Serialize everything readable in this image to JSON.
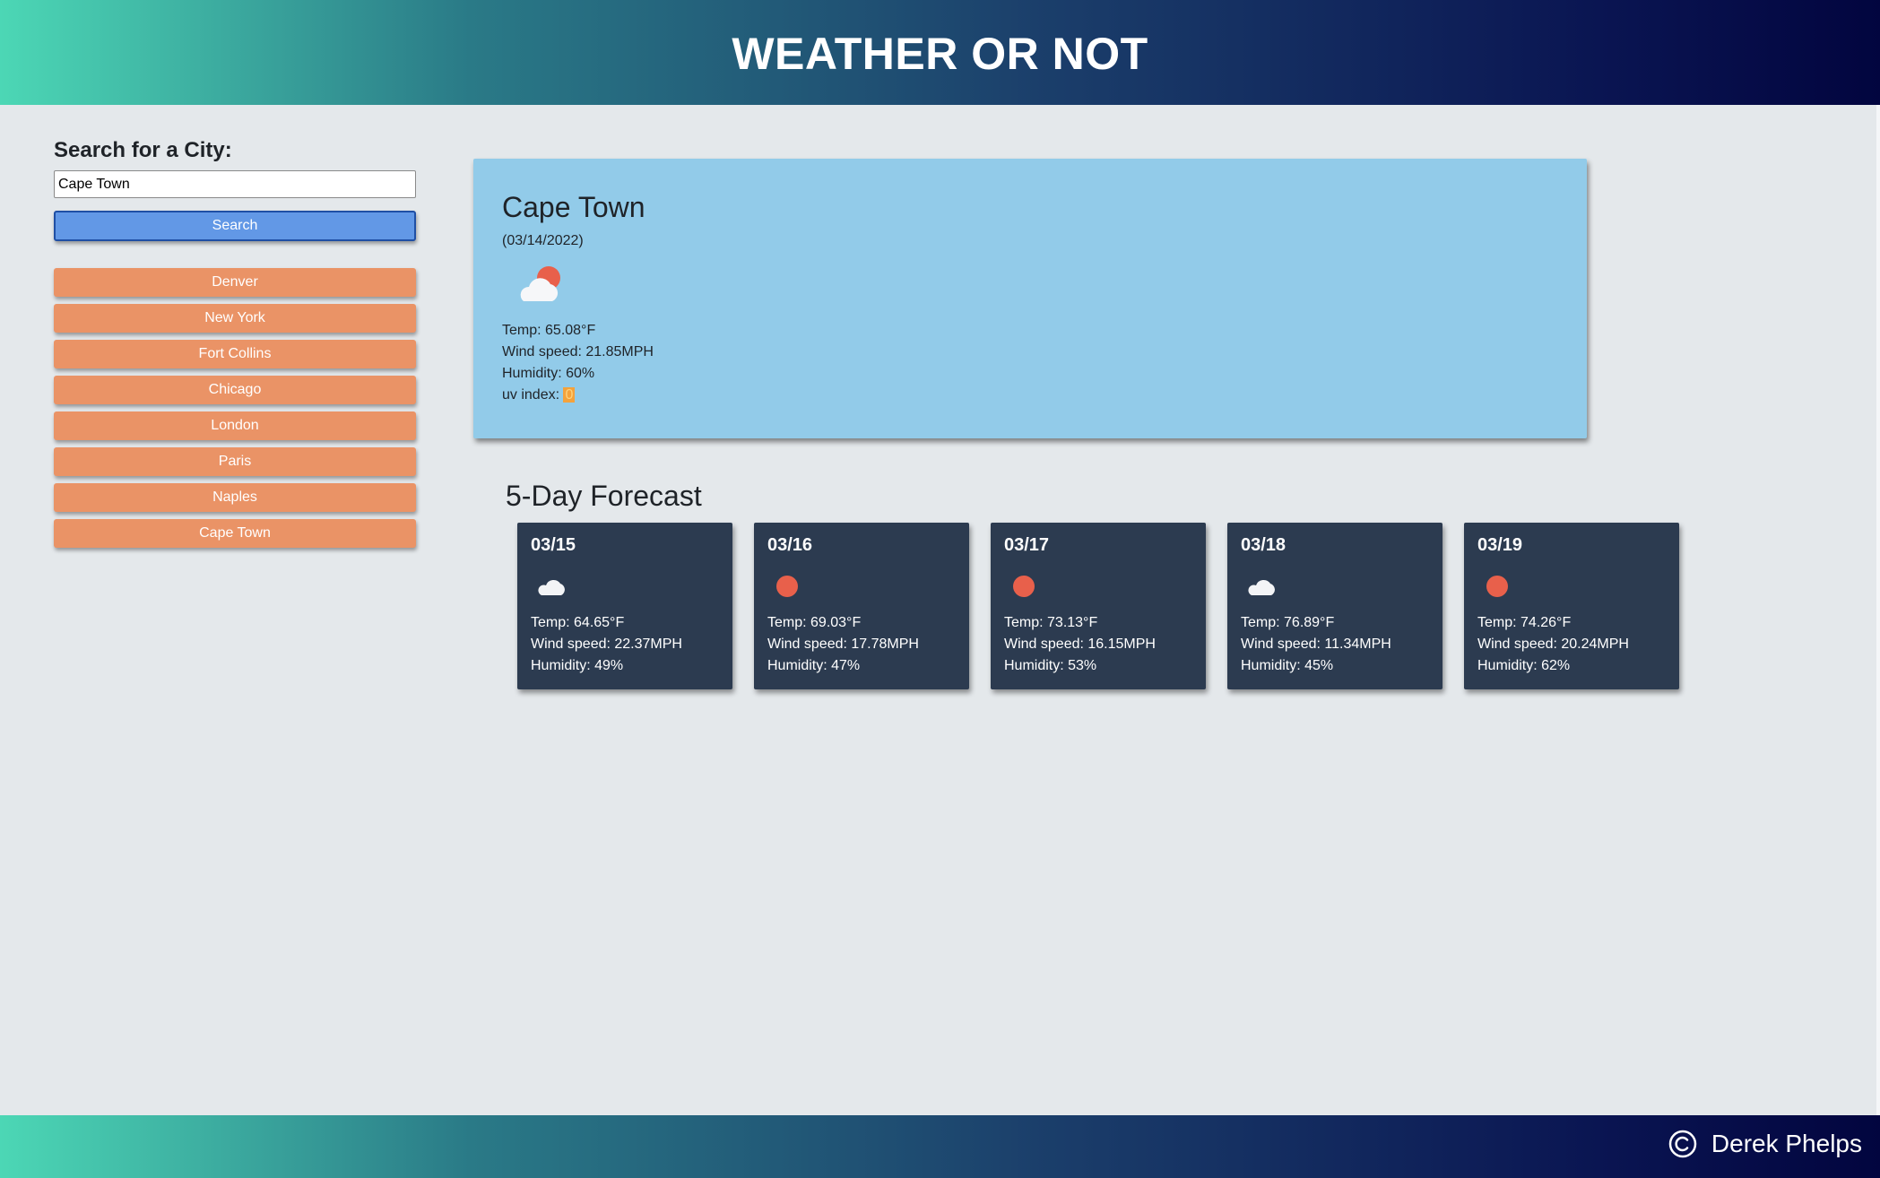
{
  "header": {
    "title": "WEATHER OR NOT"
  },
  "sidebar": {
    "search_label": "Search for a City:",
    "search_value": "Cape Town",
    "search_button": "Search",
    "history": [
      "Denver",
      "New York",
      "Fort Collins",
      "Chicago",
      "London",
      "Paris",
      "Naples",
      "Cape Town"
    ]
  },
  "current": {
    "city": "Cape Town",
    "date": "(03/14/2022)",
    "icon": "partly-cloudy-icon",
    "temp": "Temp: 65.08°F",
    "wind": "Wind speed: 21.85MPH",
    "humidity": "Humidity: 60%",
    "uv_label": "uv index: ",
    "uv_value": "0"
  },
  "forecast": {
    "title": "5-Day Forecast",
    "days": [
      {
        "date": "03/15",
        "icon": "cloud-icon",
        "temp": "Temp: 64.65°F",
        "wind": "Wind speed: 22.37MPH",
        "humidity": "Humidity: 49%"
      },
      {
        "date": "03/16",
        "icon": "sun-icon",
        "temp": "Temp: 69.03°F",
        "wind": "Wind speed: 17.78MPH",
        "humidity": "Humidity: 47%"
      },
      {
        "date": "03/17",
        "icon": "sun-icon",
        "temp": "Temp: 73.13°F",
        "wind": "Wind speed: 16.15MPH",
        "humidity": "Humidity: 53%"
      },
      {
        "date": "03/18",
        "icon": "cloud-icon",
        "temp": "Temp: 76.89°F",
        "wind": "Wind speed: 11.34MPH",
        "humidity": "Humidity: 45%"
      },
      {
        "date": "03/19",
        "icon": "sun-icon",
        "temp": "Temp: 74.26°F",
        "wind": "Wind speed: 20.24MPH",
        "humidity": "Humidity: 62%"
      }
    ]
  },
  "footer": {
    "author": "Derek Phelps",
    "icon": "copyright-icon"
  },
  "colors": {
    "history_button": "#ea9366",
    "search_button": "#6298e6",
    "current_card": "#92cbe9",
    "forecast_card": "#2c3b50",
    "sun": "#e8604b",
    "uv_badge": "#f4a23c"
  }
}
